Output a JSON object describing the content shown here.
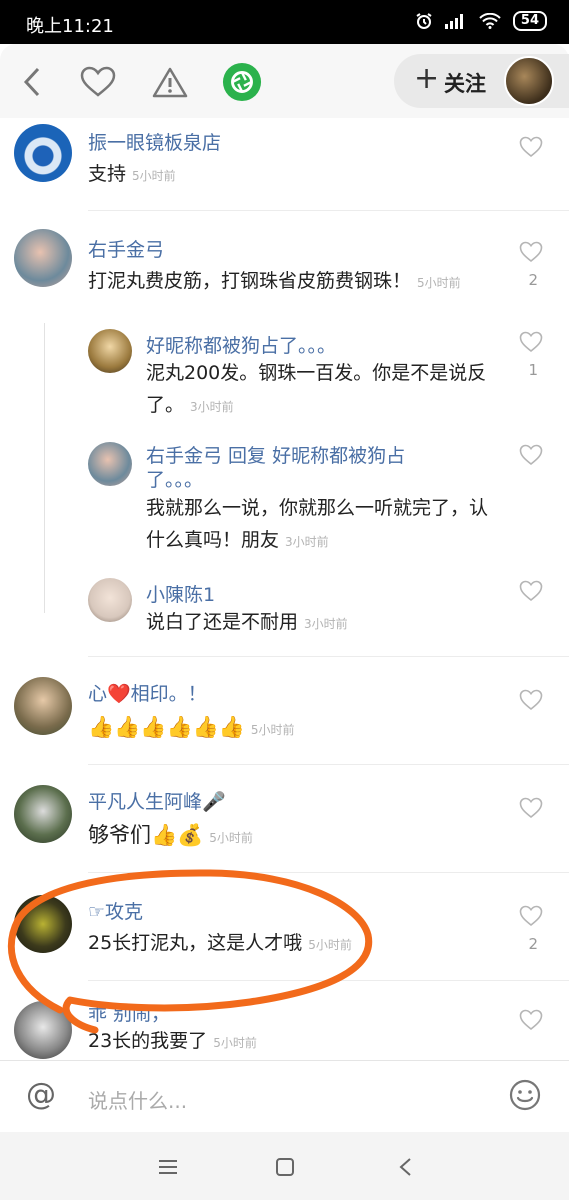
{
  "status_bar": {
    "time": "晚上11:21",
    "battery": "54"
  },
  "top_bar": {
    "follow_label": "关注",
    "follow_plus": "+"
  },
  "comments": [
    {
      "name": "振一眼镜板泉店",
      "text": "支持",
      "time": "5小时前",
      "likes": ""
    },
    {
      "name": "右手金弓",
      "text": "打泥丸费皮筋，打钢珠省皮筋费钢珠！",
      "time": "5小时前",
      "likes": "2"
    },
    {
      "name": "好昵称都被狗占了。。。",
      "text": "泥丸200发。钢珠一百发。你是不是说反了。",
      "time": "3小时前",
      "likes": "1"
    },
    {
      "name": "右手金弓  回复  好昵称都被狗占了。。。",
      "text": "我就那么一说，你就那么一听就完了，认什么真吗！朋友",
      "time": "3小时前",
      "likes": ""
    },
    {
      "name": "小陳陈1",
      "text": "说白了还是不耐用",
      "time": "3小时前",
      "likes": ""
    },
    {
      "name": "心❤️相印。！",
      "text": "👍👍👍👍👍👍",
      "time": "5小时前",
      "likes": ""
    },
    {
      "name": "平凡人生阿峰🎤",
      "text": "够爷们👍💰",
      "time": "5小时前",
      "likes": ""
    },
    {
      "name": "☞攻克",
      "text": "25长打泥丸，这是人才哦",
      "time": "5小时前",
      "likes": "2"
    },
    {
      "name": "乖    别闹，",
      "text": "23长的我要了",
      "time": "5小时前",
      "likes": ""
    }
  ],
  "input_bar": {
    "at_symbol": "@",
    "placeholder": "说点什么..."
  },
  "colors": {
    "name_blue": "#4a6fa5",
    "accent_green": "#2bb24c",
    "annotation_orange": "#f26a1b"
  }
}
